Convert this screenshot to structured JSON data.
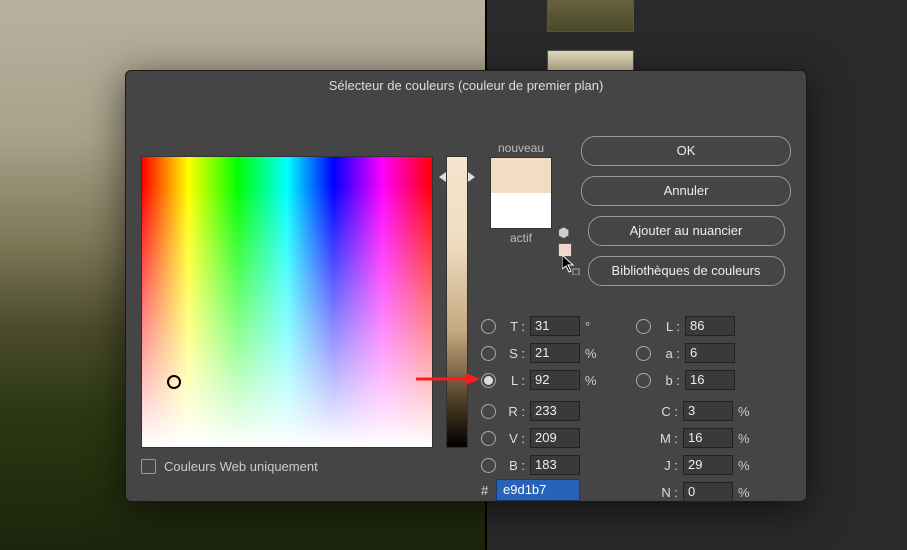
{
  "dialog": {
    "title": "Sélecteur de couleurs (couleur de premier plan)",
    "new_label": "nouveau",
    "active_label": "actif"
  },
  "buttons": {
    "ok": "OK",
    "cancel": "Annuler",
    "add_swatch": "Ajouter au nuancier",
    "libraries": "Bibliothèques de couleurs"
  },
  "webonly_label": "Couleurs Web uniquement",
  "hex": {
    "prefix": "#",
    "value": "e9d1b7"
  },
  "hsl": {
    "h": {
      "label": "T :",
      "value": "31",
      "unit": "°"
    },
    "s": {
      "label": "S :",
      "value": "21",
      "unit": "%"
    },
    "l": {
      "label": "L :",
      "value": "92",
      "unit": "%"
    }
  },
  "rvb": {
    "r": {
      "label": "R :",
      "value": "233"
    },
    "v": {
      "label": "V :",
      "value": "209"
    },
    "b": {
      "label": "B :",
      "value": "183"
    }
  },
  "lab": {
    "l": {
      "label": "L :",
      "value": "86"
    },
    "a": {
      "label": "a :",
      "value": "6"
    },
    "b": {
      "label": "b :",
      "value": "16"
    }
  },
  "cmjn": {
    "c": {
      "label": "C :",
      "value": "3",
      "unit": "%"
    },
    "m": {
      "label": "M :",
      "value": "16",
      "unit": "%"
    },
    "j": {
      "label": "J :",
      "value": "29",
      "unit": "%"
    },
    "n": {
      "label": "N :",
      "value": "0",
      "unit": "%"
    }
  },
  "colors": {
    "new": "#f1ddc1",
    "current": "#ffffff"
  },
  "annotation": {
    "arrow_target": "L"
  }
}
